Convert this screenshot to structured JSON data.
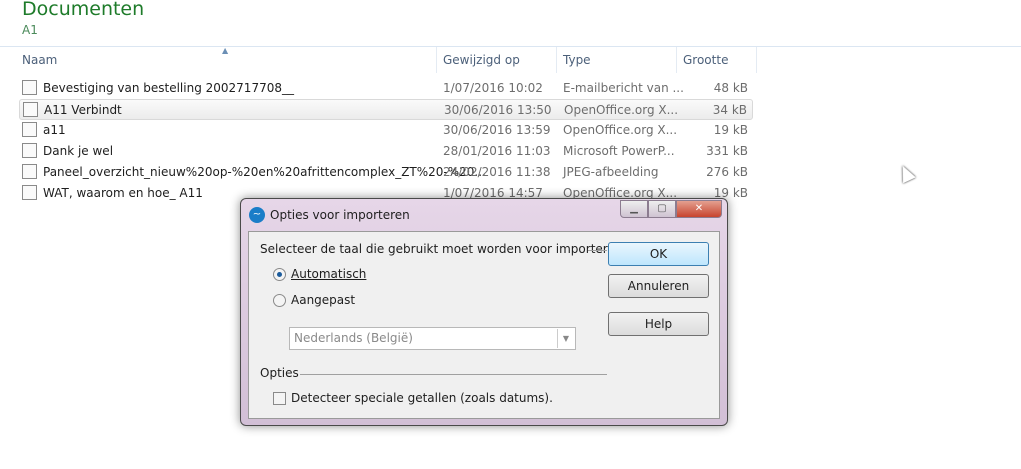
{
  "header": {
    "title": "Documenten",
    "subtitle": "A1"
  },
  "columns": [
    "Naam",
    "Gewijzigd op",
    "Type",
    "Grootte"
  ],
  "files": [
    {
      "name": "Bevestiging van bestelling 2002717708__",
      "date": "1/07/2016 10:02",
      "type": "E-mailbericht van ...",
      "size": "48 kB",
      "icon": "mail-icon"
    },
    {
      "name": "A11 Verbindt",
      "date": "30/06/2016 13:50",
      "type": "OpenOffice.org X...",
      "size": "34 kB",
      "icon": "spreadsheet-icon",
      "selected": true
    },
    {
      "name": "a11",
      "date": "30/06/2016 13:59",
      "type": "OpenOffice.org X...",
      "size": "19 kB",
      "icon": "spreadsheet-icon"
    },
    {
      "name": "Dank je wel",
      "date": "28/01/2016 11:03",
      "type": "Microsoft PowerP...",
      "size": "331 kB",
      "icon": "presentation-icon"
    },
    {
      "name": "Paneel_overzicht_nieuw%20op-%20en%20afrittencomplex_ZT%20-%20...",
      "date": "24/02/2016 11:38",
      "type": "JPEG-afbeelding",
      "size": "276 kB",
      "icon": "image-icon"
    },
    {
      "name": "WAT, waarom en hoe_ A11",
      "date": "1/07/2016 14:57",
      "type": "OpenOffice.org X...",
      "size": "19 kB",
      "icon": "spreadsheet-icon"
    }
  ],
  "dialog": {
    "title": "Opties voor importeren",
    "language_group": "Selecteer de taal die gebruikt moet worden voor importeren",
    "radio_auto": "Automatisch",
    "radio_custom": "Aangepast",
    "language_value": "Nederlands (België)",
    "options_group": "Opties",
    "checkbox_detect": "Detecteer speciale getallen (zoals datums).",
    "ok": "OK",
    "cancel": "Annuleren",
    "help": "Help"
  }
}
